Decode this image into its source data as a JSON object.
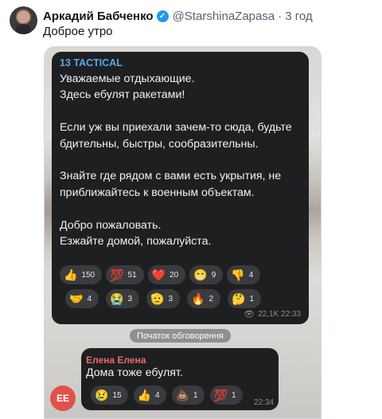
{
  "tweet": {
    "author_name": "Аркадий Бабченко",
    "verified_mark": "✓",
    "handle": "@StarshinaZapasa",
    "separator": "·",
    "time_ago": "3 год",
    "text": "Доброе утро"
  },
  "post": {
    "channel": "13 TACTICAL",
    "paragraphs": [
      "Уважаемые отдыхающие.\nЗдесь ебулят ракетами!",
      "Если уж вы приехали зачем-то сюда, будьте бдительны, быстры, сообразительны.",
      "Знайте где рядом с вами есть укрытия, не приближайтесь к военным объектам.",
      "Добро пожаловать.\nЕзжайте домой, пожалуйста."
    ],
    "reactions_row1": [
      {
        "emoji": "👍",
        "count": "150"
      },
      {
        "emoji": "💯",
        "count": "51"
      },
      {
        "emoji": "❤️",
        "count": "20"
      },
      {
        "emoji": "😁",
        "count": "9"
      },
      {
        "emoji": "👎",
        "count": "4"
      }
    ],
    "reactions_row2": [
      {
        "emoji": "🤝",
        "count": "4"
      },
      {
        "emoji": "😭",
        "count": "3"
      },
      {
        "emoji": "🫡",
        "count": "3"
      },
      {
        "emoji": "🔥",
        "count": "2"
      },
      {
        "emoji": "🤔",
        "count": "1"
      }
    ],
    "eye_glyph": "👁",
    "views_time": "22,1K 22:33"
  },
  "discussion_label": "Початок обговорення",
  "reply": {
    "avatar_initials": "ЕЕ",
    "author": "Елена Елена",
    "text": "Дома тоже ебулят.",
    "reactions": [
      {
        "emoji": "😢",
        "count": "15"
      },
      {
        "emoji": "👍",
        "count": "4"
      },
      {
        "emoji": "💩",
        "count": "1"
      },
      {
        "emoji": "💯",
        "count": "1"
      }
    ],
    "time": "22:34"
  },
  "colors": {
    "accent_blue": "#1d9bf0",
    "channel_blue": "#5aa7e8",
    "reply_author_red": "#e96a6a",
    "bubble_dark": "#1e1f21"
  }
}
